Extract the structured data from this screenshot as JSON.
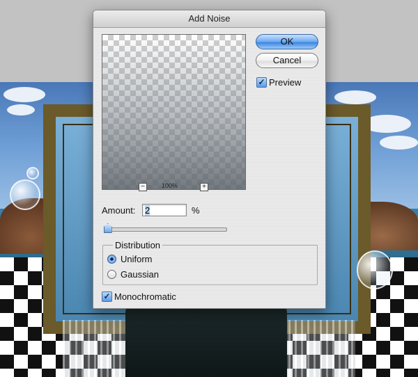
{
  "dialog": {
    "title": "Add Noise",
    "zoom": {
      "minus_icon": "minus-icon",
      "level": "100%",
      "plus_icon": "plus-icon"
    },
    "buttons": {
      "ok": "OK",
      "cancel": "Cancel"
    },
    "preview_checkbox": {
      "label": "Preview",
      "checked": true
    },
    "amount": {
      "label": "Amount:",
      "value": "2",
      "unit": "%",
      "slider_fraction": 0.01
    },
    "distribution": {
      "legend": "Distribution",
      "options": [
        {
          "label": "Uniform",
          "selected": true
        },
        {
          "label": "Gaussian",
          "selected": false
        }
      ]
    },
    "monochromatic_checkbox": {
      "label": "Monochromatic",
      "checked": true
    }
  },
  "colors": {
    "accent": "#4e8de0",
    "ok_button": "#6eaaf0"
  }
}
